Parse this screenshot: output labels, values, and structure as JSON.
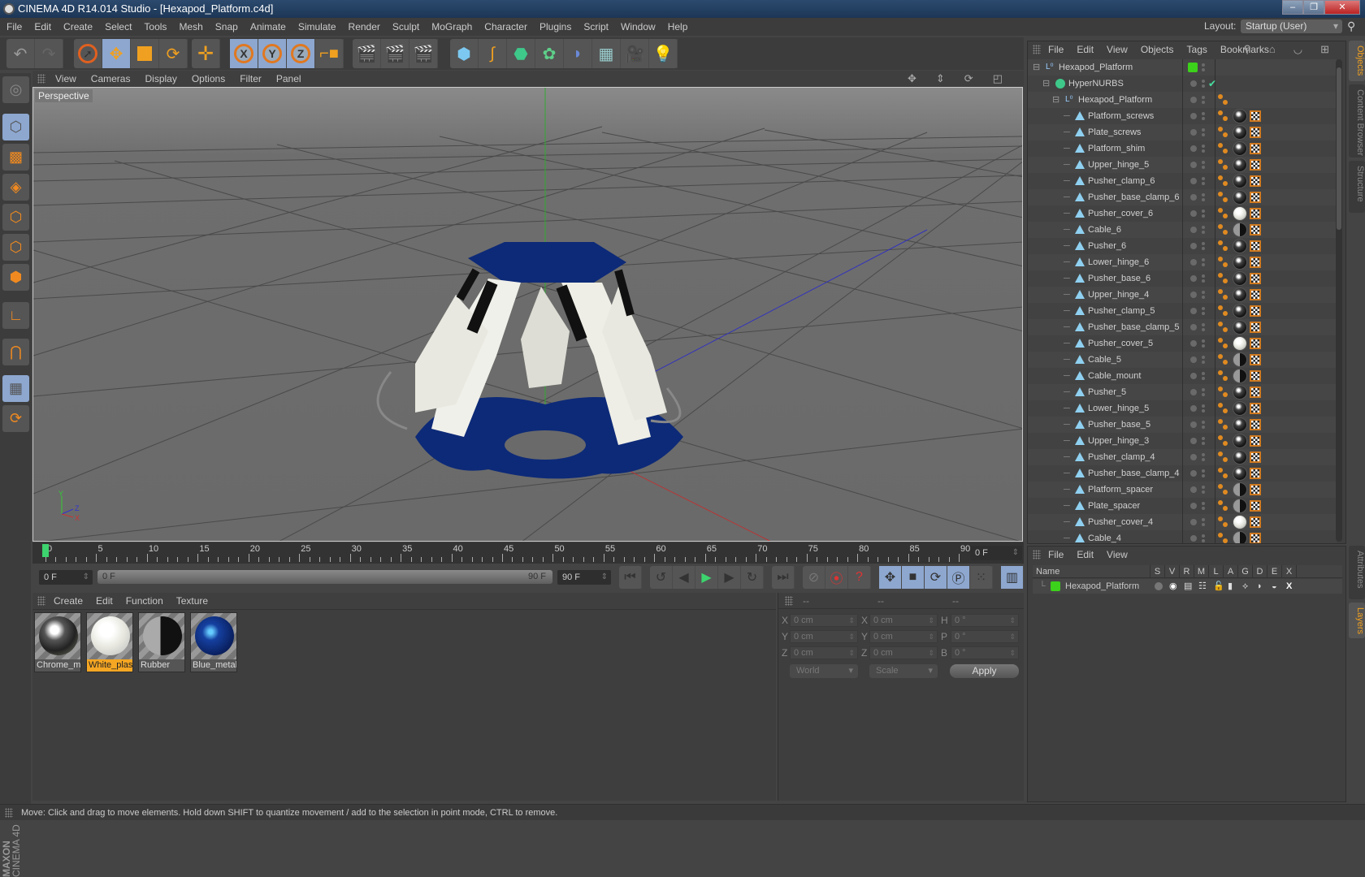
{
  "window": {
    "title": "CINEMA 4D R14.014 Studio - [Hexapod_Platform.c4d]",
    "controls": [
      "minimize",
      "maximize",
      "close"
    ]
  },
  "menubar": {
    "items": [
      "File",
      "Edit",
      "Create",
      "Select",
      "Tools",
      "Mesh",
      "Snap",
      "Animate",
      "Simulate",
      "Render",
      "Sculpt",
      "MoGraph",
      "Character",
      "Plugins",
      "Script",
      "Window",
      "Help"
    ],
    "layout_label": "Layout:",
    "layout_value": "Startup (User)"
  },
  "toolbar": {
    "icons": [
      "undo-icon",
      "redo-icon",
      "live-selection-icon",
      "move-icon",
      "scale-icon",
      "rotate-icon",
      "recent-tool-icon",
      "x-axis-lock-icon",
      "y-axis-lock-icon",
      "z-axis-lock-icon",
      "coordinate-system-icon",
      "render-view-icon",
      "render-picture-viewer-icon",
      "render-settings-icon",
      "cube-primitive-icon",
      "spline-pen-icon",
      "subdivision-surface-icon",
      "cloner-icon",
      "deformer-icon",
      "floor-icon",
      "camera-icon",
      "light-icon"
    ],
    "axis_labels": [
      "X",
      "Y",
      "Z"
    ]
  },
  "left_tools": {
    "icons": [
      "make-editable-icon",
      "model-mode-icon",
      "texture-mode-icon",
      "workplane-mode-icon",
      "points-mode-icon",
      "edges-mode-icon",
      "polygons-mode-icon",
      "axis-mode-icon",
      "magnet-snap-icon",
      "workplane-lock-icon",
      "workplane-rotate-icon"
    ],
    "logo_brand": "MAXON",
    "logo_product": "CINEMA 4D"
  },
  "viewport": {
    "menu": [
      "View",
      "Cameras",
      "Display",
      "Options",
      "Filter",
      "Panel"
    ],
    "camera_label": "Perspective",
    "nav_icons": [
      "pan-icon",
      "dolly-icon",
      "orbit-icon",
      "toggle-layout-icon"
    ],
    "axis_gizmo": {
      "x": "X",
      "y": "Y",
      "z": "Z"
    }
  },
  "timeline": {
    "ticks": [
      0,
      5,
      10,
      15,
      20,
      25,
      30,
      35,
      40,
      45,
      50,
      55,
      60,
      65,
      70,
      75,
      80,
      85,
      90
    ],
    "current_frame": "0 F",
    "start_field": "0 F",
    "range_start": "0 F",
    "range_end": "90 F",
    "end_field": "90 F",
    "playhead_frame": 0
  },
  "playback": {
    "buttons": [
      "go-to-start",
      "previous-key",
      "previous-frame",
      "play",
      "next-frame",
      "next-key",
      "go-to-end"
    ],
    "key_buttons": [
      "record-disabled",
      "autokey",
      "keyframe-selection"
    ],
    "track_buttons": [
      "position-track",
      "scale-track",
      "rotation-track",
      "parameter-track",
      "point-level-animation",
      "timeline-window"
    ]
  },
  "material_manager": {
    "menu": [
      "Create",
      "Edit",
      "Function",
      "Texture"
    ],
    "materials": [
      {
        "name": "Chrome_metal",
        "label": "Chrome_m",
        "kind": "chrome",
        "selected": false
      },
      {
        "name": "White_plastic",
        "label": "White_plas",
        "kind": "white",
        "selected": true
      },
      {
        "name": "Rubber",
        "label": "Rubber",
        "kind": "rubber",
        "selected": false
      },
      {
        "name": "Blue_metal",
        "label": "Blue_metal",
        "kind": "blue",
        "selected": false
      }
    ]
  },
  "coordinates": {
    "headers": [
      "--",
      "--",
      "--"
    ],
    "position": [
      {
        "axis": "X",
        "value": "0 cm"
      },
      {
        "axis": "Y",
        "value": "0 cm"
      },
      {
        "axis": "Z",
        "value": "0 cm"
      }
    ],
    "size": [
      {
        "axis": "X",
        "value": "0 cm"
      },
      {
        "axis": "Y",
        "value": "0 cm"
      },
      {
        "axis": "Z",
        "value": "0 cm"
      }
    ],
    "rotation": [
      {
        "axis": "H",
        "value": "0 °"
      },
      {
        "axis": "P",
        "value": "0 °"
      },
      {
        "axis": "B",
        "value": "0 °"
      }
    ],
    "mode_dropdown": "World",
    "size_dropdown": "Scale",
    "apply_label": "Apply"
  },
  "object_manager": {
    "menu": [
      "File",
      "Edit",
      "View",
      "Objects",
      "Tags",
      "Bookmarks"
    ],
    "tool_icons": [
      "search-icon",
      "home-icon",
      "eye-icon",
      "new-window-icon"
    ],
    "objects": [
      {
        "name": "Hexapod_Platform",
        "level": 0,
        "type": "null",
        "layer": true,
        "tags": []
      },
      {
        "name": "HyperNURBS",
        "level": 1,
        "type": "hypernurbs",
        "enabled": true,
        "tags": []
      },
      {
        "name": "Hexapod_Platform",
        "level": 2,
        "type": "null",
        "tags": [
          "phong"
        ]
      },
      {
        "name": "Platform_screws",
        "level": 3,
        "type": "polygon",
        "tags": [
          "phong",
          "chrome",
          "uvw"
        ]
      },
      {
        "name": "Plate_screws",
        "level": 3,
        "type": "polygon",
        "tags": [
          "phong",
          "chrome",
          "uvw"
        ]
      },
      {
        "name": "Platform_shim",
        "level": 3,
        "type": "polygon",
        "tags": [
          "phong",
          "chrome",
          "uvw"
        ]
      },
      {
        "name": "Upper_hinge_5",
        "level": 3,
        "type": "polygon",
        "tags": [
          "phong",
          "chrome",
          "uvw"
        ]
      },
      {
        "name": "Pusher_clamp_6",
        "level": 3,
        "type": "polygon",
        "tags": [
          "phong",
          "chrome",
          "uvw"
        ]
      },
      {
        "name": "Pusher_base_clamp_6",
        "level": 3,
        "type": "polygon",
        "tags": [
          "phong",
          "chrome",
          "uvw"
        ]
      },
      {
        "name": "Pusher_cover_6",
        "level": 3,
        "type": "polygon",
        "tags": [
          "phong",
          "white",
          "uvw"
        ]
      },
      {
        "name": "Cable_6",
        "level": 3,
        "type": "polygon",
        "tags": [
          "phong",
          "rubber",
          "uvw"
        ]
      },
      {
        "name": "Pusher_6",
        "level": 3,
        "type": "polygon",
        "tags": [
          "phong",
          "chrome",
          "uvw"
        ]
      },
      {
        "name": "Lower_hinge_6",
        "level": 3,
        "type": "polygon",
        "tags": [
          "phong",
          "chrome",
          "uvw"
        ]
      },
      {
        "name": "Pusher_base_6",
        "level": 3,
        "type": "polygon",
        "tags": [
          "phong",
          "chrome",
          "uvw"
        ]
      },
      {
        "name": "Upper_hinge_4",
        "level": 3,
        "type": "polygon",
        "tags": [
          "phong",
          "chrome",
          "uvw"
        ]
      },
      {
        "name": "Pusher_clamp_5",
        "level": 3,
        "type": "polygon",
        "tags": [
          "phong",
          "chrome",
          "uvw"
        ]
      },
      {
        "name": "Pusher_base_clamp_5",
        "level": 3,
        "type": "polygon",
        "tags": [
          "phong",
          "chrome",
          "uvw"
        ]
      },
      {
        "name": "Pusher_cover_5",
        "level": 3,
        "type": "polygon",
        "tags": [
          "phong",
          "white",
          "uvw"
        ]
      },
      {
        "name": "Cable_5",
        "level": 3,
        "type": "polygon",
        "tags": [
          "phong",
          "rubber",
          "uvw"
        ]
      },
      {
        "name": "Cable_mount",
        "level": 3,
        "type": "polygon",
        "tags": [
          "phong",
          "rubber",
          "uvw"
        ]
      },
      {
        "name": "Pusher_5",
        "level": 3,
        "type": "polygon",
        "tags": [
          "phong",
          "chrome",
          "uvw"
        ]
      },
      {
        "name": "Lower_hinge_5",
        "level": 3,
        "type": "polygon",
        "tags": [
          "phong",
          "chrome",
          "uvw"
        ]
      },
      {
        "name": "Pusher_base_5",
        "level": 3,
        "type": "polygon",
        "tags": [
          "phong",
          "chrome",
          "uvw"
        ]
      },
      {
        "name": "Upper_hinge_3",
        "level": 3,
        "type": "polygon",
        "tags": [
          "phong",
          "chrome",
          "uvw"
        ]
      },
      {
        "name": "Pusher_clamp_4",
        "level": 3,
        "type": "polygon",
        "tags": [
          "phong",
          "chrome",
          "uvw"
        ]
      },
      {
        "name": "Pusher_base_clamp_4",
        "level": 3,
        "type": "polygon",
        "tags": [
          "phong",
          "chrome",
          "uvw"
        ]
      },
      {
        "name": "Platform_spacer",
        "level": 3,
        "type": "polygon",
        "tags": [
          "phong",
          "rubber",
          "uvw"
        ]
      },
      {
        "name": "Plate_spacer",
        "level": 3,
        "type": "polygon",
        "tags": [
          "phong",
          "rubber",
          "uvw"
        ]
      },
      {
        "name": "Pusher_cover_4",
        "level": 3,
        "type": "polygon",
        "tags": [
          "phong",
          "white",
          "uvw"
        ]
      },
      {
        "name": "Cable_4",
        "level": 3,
        "type": "polygon",
        "tags": [
          "phong",
          "rubber",
          "uvw"
        ]
      }
    ]
  },
  "right_tabs_top": [
    {
      "label": "Objects",
      "active": true
    },
    {
      "label": "Content Browser",
      "active": false
    },
    {
      "label": "Structure",
      "active": false
    }
  ],
  "right_tabs_bottom": [
    {
      "label": "Attributes",
      "active": false
    },
    {
      "label": "Layers",
      "active": true
    }
  ],
  "layer_manager": {
    "menu": [
      "File",
      "Edit",
      "View"
    ],
    "columns": [
      "Name",
      "S",
      "V",
      "R",
      "M",
      "L",
      "A",
      "G",
      "D",
      "E",
      "X"
    ],
    "layers": [
      {
        "name": "Hexapod_Platform",
        "color": "#3cd11a"
      }
    ]
  },
  "status_bar": {
    "text": "Move: Click and drag to move elements. Hold down SHIFT to quantize movement / add to the selection in point mode, CTRL to remove."
  },
  "colors": {
    "accent_orange": "#f0a020",
    "selection_blue": "#8da7cf",
    "layer_green": "#3cd11a",
    "playhead_green": "#3dd36e",
    "platform_blue": "#0d2a78"
  }
}
